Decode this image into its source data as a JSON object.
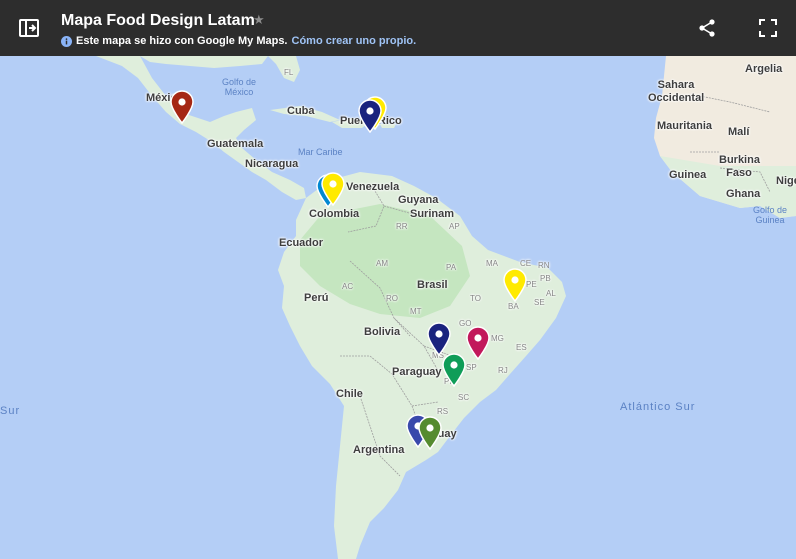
{
  "header": {
    "title": "Mapa Food Design Latam",
    "subtitle_text": "Este mapa se hizo con Google My Maps.",
    "subtitle_link": "Cómo crear uno propio.",
    "icons": [
      "sidebar-toggle-icon",
      "star-icon",
      "info-icon",
      "share-icon",
      "fullscreen-icon"
    ]
  },
  "map": {
    "countries": [
      "México",
      "Cuba",
      "Puerto Rico",
      "Guatemala",
      "Nicaragua",
      "Venezuela",
      "Colombia",
      "Guyana",
      "Surinam",
      "Ecuador",
      "Brasil",
      "Perú",
      "Bolivia",
      "Paraguay",
      "Chile",
      "Argentina",
      "Uruguay",
      "Sahara Occidental",
      "Argelia",
      "Mauritania",
      "Malí",
      "Burkina Faso",
      "Guinea",
      "Ghana",
      "Nigeria"
    ],
    "states": [
      "FL",
      "RR",
      "AP",
      "AM",
      "PA",
      "MA",
      "CE",
      "RN",
      "PB",
      "PE",
      "AL",
      "SE",
      "AC",
      "RO",
      "TO",
      "BA",
      "MT",
      "GO",
      "MG",
      "ES",
      "MS",
      "SP",
      "RJ",
      "PR",
      "SC",
      "RS"
    ],
    "water": [
      "Golfo de México",
      "Mar Caribe",
      "Golfo de Guinea"
    ],
    "oceans": [
      "Atlántico Sur",
      "Sur"
    ],
    "marker_colors": {
      "red": "#a52714",
      "navy": "#1a237e",
      "yellow": "#ffea00",
      "blue": "#0288d1",
      "magenta": "#c2185b",
      "green": "#0f9d58",
      "olive": "#558b2f",
      "indigo": "#3949ab"
    },
    "colors": {
      "water": "#b4cef6",
      "land": "#dfeedc",
      "forest": "#c5e6c0",
      "desert": "#f1ebe0",
      "border": "#9e9e9e"
    }
  }
}
